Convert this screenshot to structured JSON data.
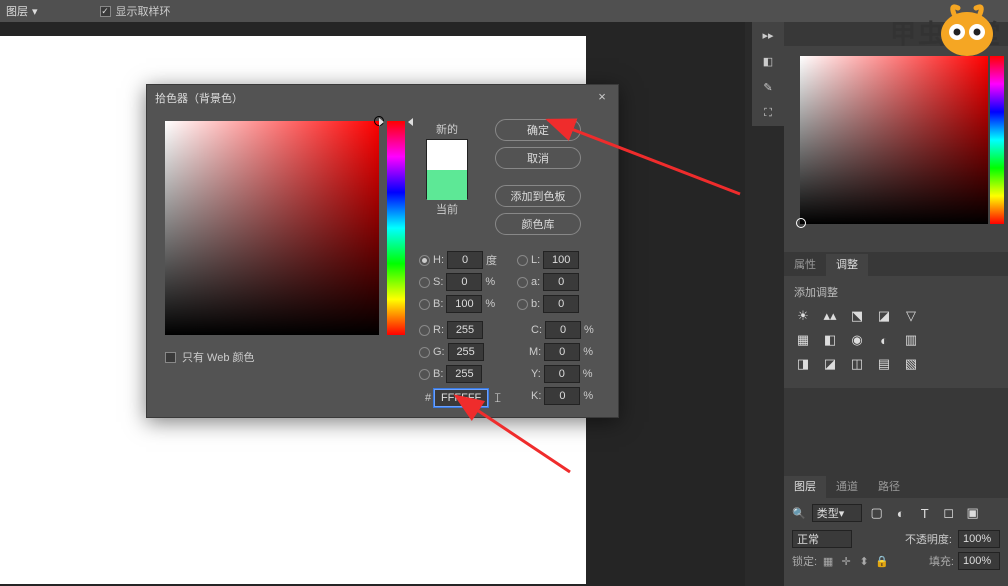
{
  "topbar": {
    "layer_dropdown": "图层",
    "show_sample_ring": "显示取样环"
  },
  "dialog": {
    "title": "拾色器（背景色）",
    "close": "×",
    "new_label": "新的",
    "current_label": "当前",
    "buttons": {
      "ok": "确定",
      "cancel": "取消",
      "add_swatch": "添加到色板",
      "color_lib": "颜色库"
    },
    "fields": {
      "H": {
        "label": "H:",
        "value": "0",
        "unit": "度"
      },
      "S": {
        "label": "S:",
        "value": "0",
        "unit": "%"
      },
      "Bv": {
        "label": "B:",
        "value": "100",
        "unit": "%"
      },
      "R": {
        "label": "R:",
        "value": "255"
      },
      "G": {
        "label": "G:",
        "value": "255"
      },
      "Bb": {
        "label": "B:",
        "value": "255"
      },
      "L": {
        "label": "L:",
        "value": "100"
      },
      "a": {
        "label": "a:",
        "value": "0"
      },
      "b2": {
        "label": "b:",
        "value": "0"
      },
      "C": {
        "label": "C:",
        "value": "0",
        "unit": "%"
      },
      "M": {
        "label": "M:",
        "value": "0",
        "unit": "%"
      },
      "Y": {
        "label": "Y:",
        "value": "0",
        "unit": "%"
      },
      "K": {
        "label": "K:",
        "value": "0",
        "unit": "%"
      },
      "hex_label": "#",
      "hex": "FFFFFF"
    },
    "web_only": "只有 Web 颜色"
  },
  "right": {
    "props_tab": "属性",
    "adjust_tab": "调整",
    "adjust_title": "添加调整",
    "layers_tab": "图层",
    "channels_tab": "通道",
    "paths_tab": "路径",
    "type_search": "类型",
    "blend": "正常",
    "opacity_label": "不透明度:",
    "opacity_value": "100%",
    "lock_label": "锁定:",
    "fill_label": "填充:",
    "fill_value": "100%"
  },
  "watermark": "甲虫课堂"
}
